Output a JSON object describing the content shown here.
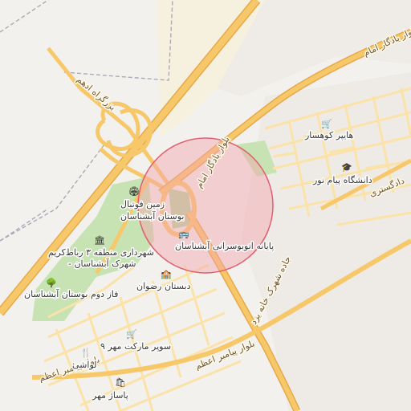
{
  "map": {
    "roads": {
      "ostad_ostad": "بزرگراه ادهم",
      "yadegar_imam_ne": "بلوار یادگار امام",
      "yadegar_imam_center": "بلوار یادگار امام",
      "dadgostari": "دادگستری",
      "khaneh_shahr_road": "جاده شهرک خانه یزد",
      "payambar_azam_lower": "بلوار پیامبر اعظم",
      "payambar_azam_left": "بلوار پیامبر اعظم"
    },
    "pois": {
      "hyper_kowsar": "هایپر کوهسار",
      "payam_noor": "دانشگاه پیام نور",
      "football_field": "زمین فوتبال",
      "boostan_ashtanan": "بوستان آبشناسان",
      "bus_terminal": "پایانه اتوبوسرانی آبشناسان",
      "municipality": "شهرداری منطقه ۳ رباط‌کریم",
      "municipality_sub": "- شهرک آبشناسان",
      "park_phase2": "فاز دوم بوستان آبشناسان",
      "school_rezvan": "دبستان رضوان",
      "super_market": "سوپر مارکت مهر ۹",
      "lavashi": "لواشی",
      "pasaj_mehr": "پاساژ مهر"
    },
    "colors": {
      "background": "#f3f1ee",
      "major_road": "#f7c86a",
      "major_road_casing": "#e6a94a",
      "minor_road": "#fbe2a8",
      "park": "#c7e3b3",
      "highlight_fill": "#f5a4ad",
      "highlight_stroke": "#e06070"
    }
  }
}
